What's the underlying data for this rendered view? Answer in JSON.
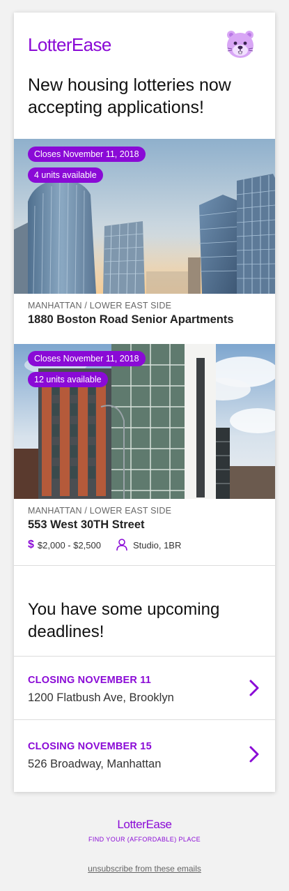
{
  "brand": {
    "name": "LotterEase",
    "accent_color": "#8a0ad6",
    "mascot_icon": "otter-face-icon"
  },
  "header": {
    "headline": "New housing lotteries now accepting applications!"
  },
  "listings": [
    {
      "closes": "Closes November 11, 2018",
      "units": "4 units available",
      "neighborhood": "MANHATTAN / LOWER EAST SIDE",
      "name": "1880 Boston Road Senior Apartments",
      "photo": "glass-towers-photo"
    },
    {
      "closes": "Closes November 11, 2018",
      "units": "12 units available",
      "neighborhood": "MANHATTAN / LOWER EAST SIDE",
      "name": "553 West 30TH Street",
      "photo": "apartment-building-photo",
      "price_icon": "$",
      "price": "$2,000 - $2,500",
      "unit_types": "Studio, 1BR"
    }
  ],
  "deadlines": {
    "title": "You have some upcoming deadlines!",
    "items": [
      {
        "label": "CLOSING NOVEMBER 11",
        "address": "1200 Flatbush Ave, Brooklyn"
      },
      {
        "label": "CLOSING NOVEMBER 15",
        "address": "526 Broadway, Manhattan"
      }
    ]
  },
  "footer": {
    "brand": "LotterEase",
    "tagline": "FIND YOUR (AFFORDABLE) PLACE",
    "unsubscribe": "unsubscribe from these emails"
  }
}
